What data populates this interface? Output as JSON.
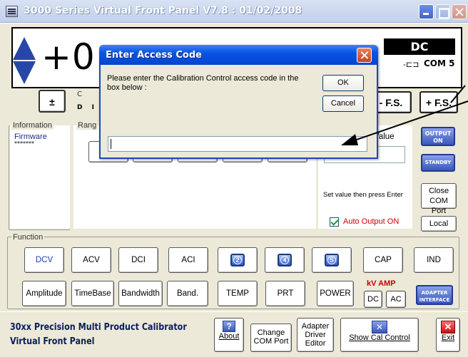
{
  "window": {
    "title": "3000 Series Virtual Front Panel V7.8 : 01/02/2008"
  },
  "display": {
    "readout": "+0",
    "mode": "DC",
    "com_port": "COM 5"
  },
  "top_controls": {
    "pm_label": "±",
    "minus_fs": "- F.S.",
    "plus_fs": "+ F.S.",
    "radio_c": "C",
    "radio_di": "D I"
  },
  "info_panel": {
    "legend": "Information",
    "firmware_label": "Firmware",
    "firmware_value": "*******"
  },
  "range_panel": {
    "legend": "Rang",
    "first_btn_label": "2"
  },
  "value_panel": {
    "legend": "Value",
    "hint": "Set value then press Enter",
    "auto_output": "Auto Output ON"
  },
  "right_buttons": {
    "output_on": "OUTPUT ON",
    "standby": "STANDBY",
    "close_com": "Close COM Port",
    "local": "Local"
  },
  "function": {
    "legend": "Function",
    "row1": [
      "DCV",
      "ACV",
      "DCI",
      "ACI",
      "2",
      "4",
      "S",
      "CAP",
      "IND"
    ],
    "row2": [
      "Amplitude",
      "TimeBase",
      "Bandwidth",
      "Band. REF",
      "TEMP",
      "PRT",
      "POWER"
    ],
    "kv_amp": "kV AMP",
    "kv_dc": "DC",
    "kv_ac": "AC",
    "adapter_interface": "ADAPTER INTERFACE"
  },
  "footer": {
    "brand_line1": "30xx Precision Multi Product Calibrator",
    "brand_line2": "Virtual Front Panel",
    "about": "About",
    "change_com": "Change COM Port",
    "adapter_driver": "Adapter Driver Editor",
    "show_cal": "Show Cal Control",
    "exit": "Exit"
  },
  "dialog": {
    "title": "Enter Access Code",
    "message": "Please enter the Calibration Control access code in the box below :",
    "ok": "OK",
    "cancel": "Cancel",
    "input_value": ""
  },
  "colors": {
    "accent": "#0a54e3",
    "title_shadow": "#0344d0",
    "warning_red": "#cc0000",
    "dark_navy": "#0a1e5c"
  }
}
